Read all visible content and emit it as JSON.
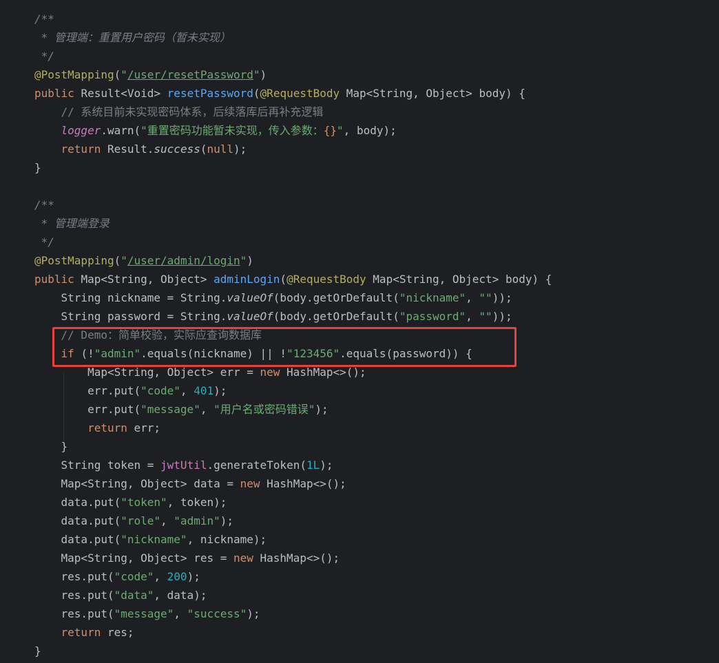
{
  "editor": {
    "language": "java",
    "highlight_color": "#e0443a",
    "lines": [
      {
        "tokens": [
          {
            "t": "/**",
            "c": "c-comment"
          }
        ]
      },
      {
        "tokens": [
          {
            "t": " * 管理端：重置用户密码（暂未实现）",
            "c": "c-comment"
          }
        ]
      },
      {
        "tokens": [
          {
            "t": " */",
            "c": "c-comment"
          }
        ]
      },
      {
        "tokens": [
          {
            "t": "@PostMapping",
            "c": "c-anno"
          },
          {
            "t": "(",
            "c": "c-plain"
          },
          {
            "t": "\"",
            "c": "c-str"
          },
          {
            "t": "/user/resetPassword",
            "c": "c-url"
          },
          {
            "t": "\"",
            "c": "c-str"
          },
          {
            "t": ")",
            "c": "c-plain"
          }
        ]
      },
      {
        "tokens": [
          {
            "t": "public ",
            "c": "c-kw"
          },
          {
            "t": "Result<Void> ",
            "c": "c-plain"
          },
          {
            "t": "resetPassword",
            "c": "c-fn"
          },
          {
            "t": "(",
            "c": "c-plain"
          },
          {
            "t": "@RequestBody ",
            "c": "c-anno"
          },
          {
            "t": "Map<String, Object> body) {",
            "c": "c-plain"
          }
        ]
      },
      {
        "tokens": [
          {
            "t": "    // 系统目前未实现密码体系，后续落库后再补充逻辑",
            "c": "c-comment-plain"
          }
        ]
      },
      {
        "tokens": [
          {
            "t": "    ",
            "c": "c-plain"
          },
          {
            "t": "logger",
            "c": "c-field-i"
          },
          {
            "t": ".warn(",
            "c": "c-plain"
          },
          {
            "t": "\"重置密码功能暂未实现，传入参数：",
            "c": "c-str"
          },
          {
            "t": "{}",
            "c": "c-kw"
          },
          {
            "t": "\"",
            "c": "c-str"
          },
          {
            "t": ", body);",
            "c": "c-plain"
          }
        ]
      },
      {
        "tokens": [
          {
            "t": "    ",
            "c": "c-plain"
          },
          {
            "t": "return ",
            "c": "c-kw"
          },
          {
            "t": "Result.",
            "c": "c-plain"
          },
          {
            "t": "success",
            "c": "c-static"
          },
          {
            "t": "(",
            "c": "c-plain"
          },
          {
            "t": "null",
            "c": "c-kw"
          },
          {
            "t": ");",
            "c": "c-plain"
          }
        ]
      },
      {
        "tokens": [
          {
            "t": "}",
            "c": "c-plain"
          }
        ]
      },
      {
        "tokens": []
      },
      {
        "tokens": [
          {
            "t": "/**",
            "c": "c-comment"
          }
        ]
      },
      {
        "tokens": [
          {
            "t": " * 管理端登录",
            "c": "c-comment"
          }
        ]
      },
      {
        "tokens": [
          {
            "t": " */",
            "c": "c-comment"
          }
        ]
      },
      {
        "tokens": [
          {
            "t": "@PostMapping",
            "c": "c-anno"
          },
          {
            "t": "(",
            "c": "c-plain"
          },
          {
            "t": "\"",
            "c": "c-str"
          },
          {
            "t": "/user/admin/login",
            "c": "c-url"
          },
          {
            "t": "\"",
            "c": "c-str"
          },
          {
            "t": ")",
            "c": "c-plain"
          }
        ]
      },
      {
        "tokens": [
          {
            "t": "public ",
            "c": "c-kw"
          },
          {
            "t": "Map<String, Object> ",
            "c": "c-plain"
          },
          {
            "t": "adminLogin",
            "c": "c-fn"
          },
          {
            "t": "(",
            "c": "c-plain"
          },
          {
            "t": "@RequestBody ",
            "c": "c-anno"
          },
          {
            "t": "Map<String, Object> body) {",
            "c": "c-plain"
          }
        ]
      },
      {
        "tokens": [
          {
            "t": "    String nickname = String.",
            "c": "c-plain"
          },
          {
            "t": "valueOf",
            "c": "c-static"
          },
          {
            "t": "(body.getOrDefault(",
            "c": "c-plain"
          },
          {
            "t": "\"nickname\"",
            "c": "c-str"
          },
          {
            "t": ", ",
            "c": "c-plain"
          },
          {
            "t": "\"\"",
            "c": "c-str"
          },
          {
            "t": "));",
            "c": "c-plain"
          }
        ]
      },
      {
        "tokens": [
          {
            "t": "    String password = String.",
            "c": "c-plain"
          },
          {
            "t": "valueOf",
            "c": "c-static"
          },
          {
            "t": "(body.getOrDefault(",
            "c": "c-plain"
          },
          {
            "t": "\"password\"",
            "c": "c-str"
          },
          {
            "t": ", ",
            "c": "c-plain"
          },
          {
            "t": "\"\"",
            "c": "c-str"
          },
          {
            "t": "));",
            "c": "c-plain"
          }
        ]
      },
      {
        "tokens": [
          {
            "t": "    // Demo：简单校验，实际应查询数据库",
            "c": "c-comment-plain"
          }
        ]
      },
      {
        "tokens": [
          {
            "t": "    ",
            "c": "c-plain"
          },
          {
            "t": "if ",
            "c": "c-kw"
          },
          {
            "t": "(!",
            "c": "c-plain"
          },
          {
            "t": "\"admin\"",
            "c": "c-str"
          },
          {
            "t": ".equals(nickname) || !",
            "c": "c-plain"
          },
          {
            "t": "\"123456\"",
            "c": "c-str"
          },
          {
            "t": ".equals(password)) {",
            "c": "c-plain"
          }
        ]
      },
      {
        "tokens": [
          {
            "t": "        Map<String, Object> err = ",
            "c": "c-plain"
          },
          {
            "t": "new ",
            "c": "c-kw"
          },
          {
            "t": "HashMap<>();",
            "c": "c-plain"
          }
        ]
      },
      {
        "tokens": [
          {
            "t": "        err.put(",
            "c": "c-plain"
          },
          {
            "t": "\"code\"",
            "c": "c-str"
          },
          {
            "t": ", ",
            "c": "c-plain"
          },
          {
            "t": "401",
            "c": "c-num"
          },
          {
            "t": ");",
            "c": "c-plain"
          }
        ]
      },
      {
        "tokens": [
          {
            "t": "        err.put(",
            "c": "c-plain"
          },
          {
            "t": "\"message\"",
            "c": "c-str"
          },
          {
            "t": ", ",
            "c": "c-plain"
          },
          {
            "t": "\"用户名或密码错误\"",
            "c": "c-str"
          },
          {
            "t": ");",
            "c": "c-plain"
          }
        ]
      },
      {
        "tokens": [
          {
            "t": "        ",
            "c": "c-plain"
          },
          {
            "t": "return ",
            "c": "c-kw"
          },
          {
            "t": "err;",
            "c": "c-plain"
          }
        ]
      },
      {
        "tokens": [
          {
            "t": "    }",
            "c": "c-plain"
          }
        ]
      },
      {
        "tokens": [
          {
            "t": "    String token = ",
            "c": "c-plain"
          },
          {
            "t": "jwtUtil",
            "c": "c-field"
          },
          {
            "t": ".generateToken(",
            "c": "c-plain"
          },
          {
            "t": "1L",
            "c": "c-num"
          },
          {
            "t": ");",
            "c": "c-plain"
          }
        ]
      },
      {
        "tokens": [
          {
            "t": "    Map<String, Object> data = ",
            "c": "c-plain"
          },
          {
            "t": "new ",
            "c": "c-kw"
          },
          {
            "t": "HashMap<>();",
            "c": "c-plain"
          }
        ]
      },
      {
        "tokens": [
          {
            "t": "    data.put(",
            "c": "c-plain"
          },
          {
            "t": "\"token\"",
            "c": "c-str"
          },
          {
            "t": ", token);",
            "c": "c-plain"
          }
        ]
      },
      {
        "tokens": [
          {
            "t": "    data.put(",
            "c": "c-plain"
          },
          {
            "t": "\"role\"",
            "c": "c-str"
          },
          {
            "t": ", ",
            "c": "c-plain"
          },
          {
            "t": "\"admin\"",
            "c": "c-str"
          },
          {
            "t": ");",
            "c": "c-plain"
          }
        ]
      },
      {
        "tokens": [
          {
            "t": "    data.put(",
            "c": "c-plain"
          },
          {
            "t": "\"nickname\"",
            "c": "c-str"
          },
          {
            "t": ", nickname);",
            "c": "c-plain"
          }
        ]
      },
      {
        "tokens": [
          {
            "t": "    Map<String, Object> res = ",
            "c": "c-plain"
          },
          {
            "t": "new ",
            "c": "c-kw"
          },
          {
            "t": "HashMap<>();",
            "c": "c-plain"
          }
        ]
      },
      {
        "tokens": [
          {
            "t": "    res.put(",
            "c": "c-plain"
          },
          {
            "t": "\"code\"",
            "c": "c-str"
          },
          {
            "t": ", ",
            "c": "c-plain"
          },
          {
            "t": "200",
            "c": "c-num"
          },
          {
            "t": ");",
            "c": "c-plain"
          }
        ]
      },
      {
        "tokens": [
          {
            "t": "    res.put(",
            "c": "c-plain"
          },
          {
            "t": "\"data\"",
            "c": "c-str"
          },
          {
            "t": ", data);",
            "c": "c-plain"
          }
        ]
      },
      {
        "tokens": [
          {
            "t": "    res.put(",
            "c": "c-plain"
          },
          {
            "t": "\"message\"",
            "c": "c-str"
          },
          {
            "t": ", ",
            "c": "c-plain"
          },
          {
            "t": "\"success\"",
            "c": "c-str"
          },
          {
            "t": ");",
            "c": "c-plain"
          }
        ]
      },
      {
        "tokens": [
          {
            "t": "    ",
            "c": "c-plain"
          },
          {
            "t": "return ",
            "c": "c-kw"
          },
          {
            "t": "res;",
            "c": "c-plain"
          }
        ]
      },
      {
        "tokens": [
          {
            "t": "}",
            "c": "c-plain"
          }
        ]
      }
    ]
  }
}
